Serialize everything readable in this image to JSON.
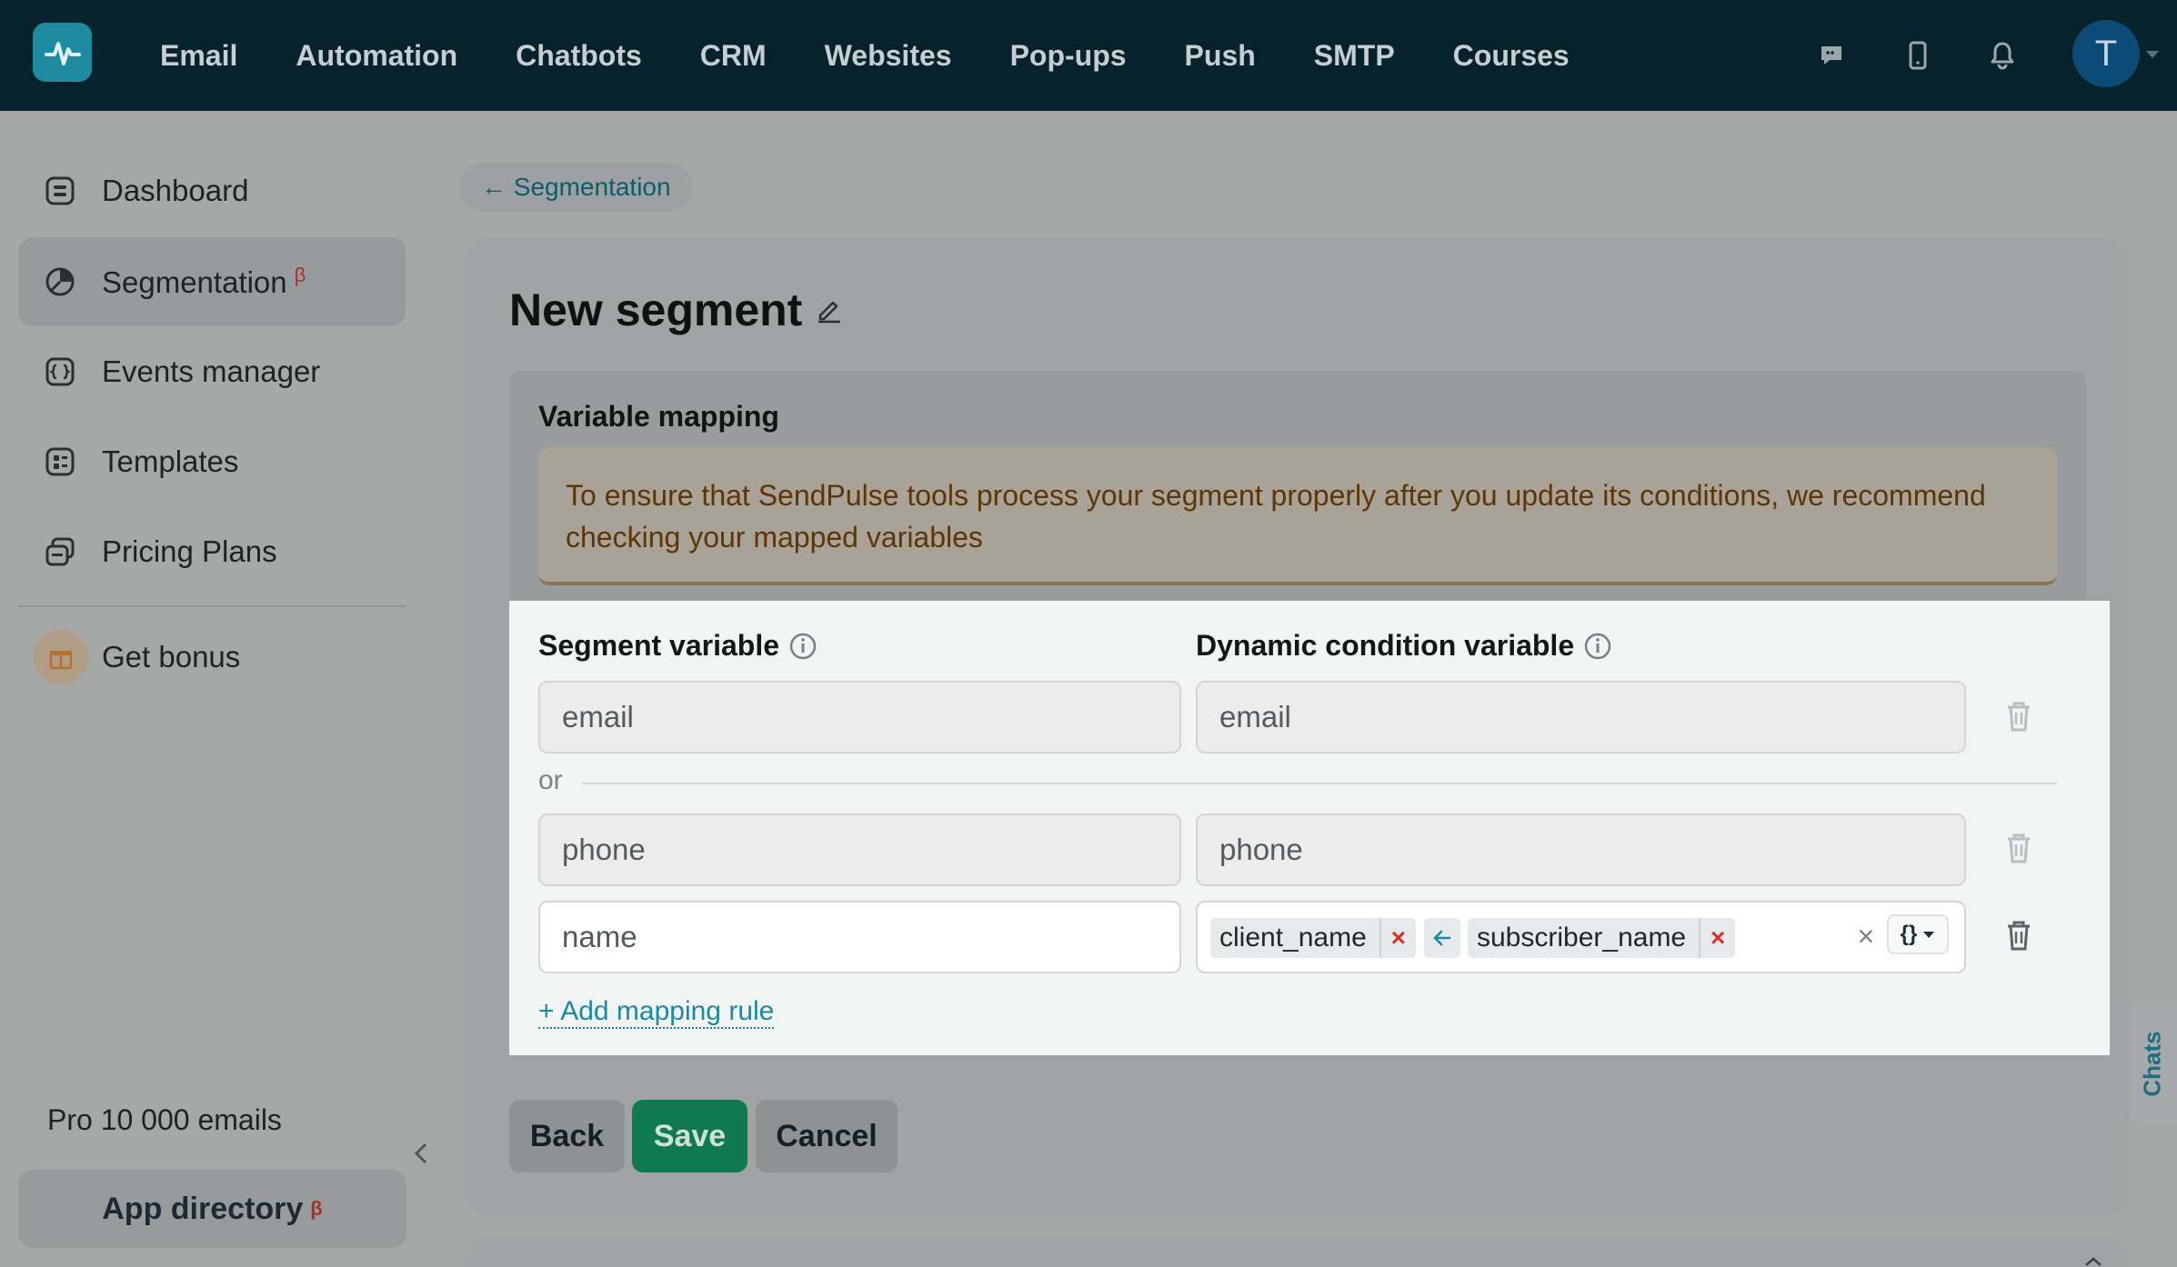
{
  "topbar": {
    "nav": [
      "Email",
      "Automation",
      "Chatbots",
      "CRM",
      "Websites",
      "Pop-ups",
      "Push",
      "SMTP",
      "Courses"
    ],
    "avatar_letter": "T"
  },
  "sidebar": {
    "items": [
      {
        "label": "Dashboard",
        "icon": "dashboard-icon"
      },
      {
        "label": "Segmentation",
        "icon": "segmentation-icon",
        "badge": "β"
      },
      {
        "label": "Events manager",
        "icon": "events-icon"
      },
      {
        "label": "Templates",
        "icon": "templates-icon"
      },
      {
        "label": "Pricing Plans",
        "icon": "pricing-icon"
      }
    ],
    "bonus_label": "Get bonus",
    "plan": "Pro 10 000 emails",
    "app_directory": "App directory",
    "app_directory_badge": "β"
  },
  "breadcrumb": "← Segmentation",
  "page_title": "New segment",
  "mapping": {
    "title": "Variable mapping",
    "warning": "To ensure that SendPulse tools process your segment properly after you update its conditions, we recommend checking your mapped variables",
    "segment_header": "Segment variable",
    "dynamic_header": "Dynamic condition variable",
    "or_label": "or",
    "rows": [
      {
        "segment": "email",
        "dynamic": "email"
      },
      {
        "segment": "phone",
        "dynamic": "phone"
      },
      {
        "segment": "name"
      }
    ],
    "tags": [
      "client_name",
      "subscriber_name"
    ],
    "tag_remove": "×",
    "clear": "×",
    "picker": "{}",
    "add_rule": "+ Add mapping rule"
  },
  "actions": {
    "back": "Back",
    "save": "Save",
    "cancel": "Cancel"
  },
  "chats_tab": "Chats",
  "colors": {
    "accent": "#1d8aa1",
    "save": "#0f7a4e",
    "warning_text": "#5c3606",
    "remove": "#d9302b"
  }
}
